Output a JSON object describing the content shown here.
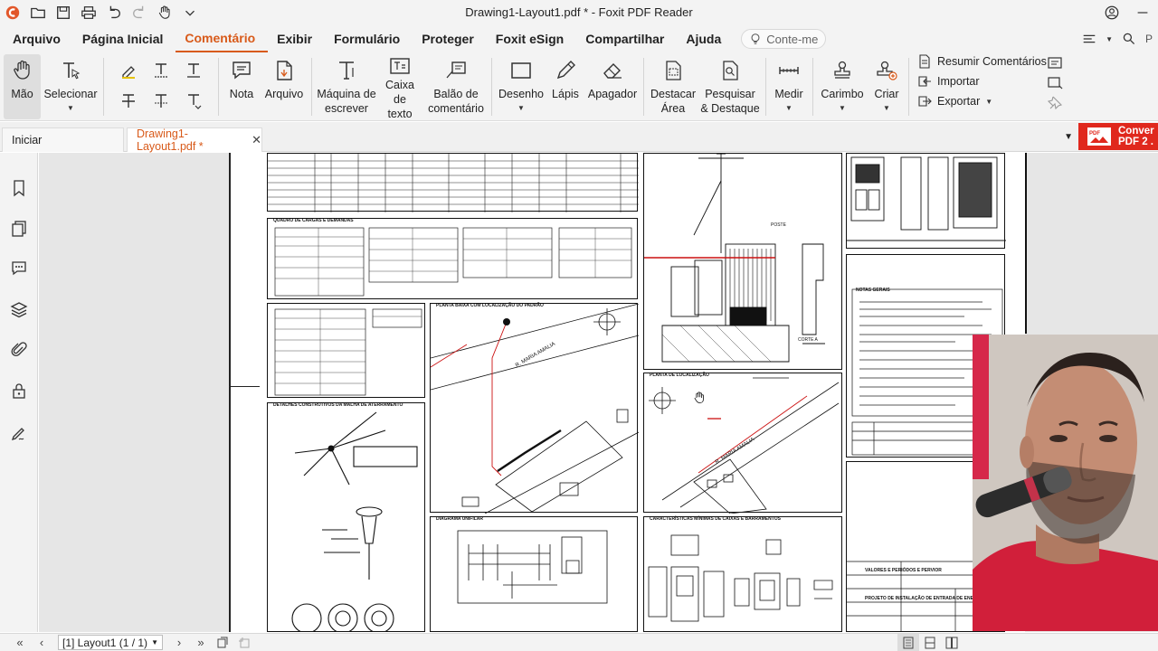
{
  "window": {
    "title": "Drawing1-Layout1.pdf * - Foxit PDF Reader"
  },
  "menu": {
    "items": [
      "Arquivo",
      "Página Inicial",
      "Comentário",
      "Exibir",
      "Formulário",
      "Proteger",
      "Foxit eSign",
      "Compartilhar",
      "Ajuda"
    ],
    "active": "Comentário",
    "search_label": "Conte-me",
    "right_fragment": "P"
  },
  "ribbon": {
    "hand_label": "Mão",
    "select_label": "Selecionar",
    "note_label": "Nota",
    "file_label": "Arquivo",
    "typewriter_label": "Máquina de escrever",
    "textbox_label": "Caixa de texto",
    "callout_label": "Balão de comentário",
    "drawing_label": "Desenho",
    "pencil_label": "Lápis",
    "eraser_label": "Apagador",
    "highlight_area_label": "Destacar Área",
    "search_highlight_label": "Pesquisar & Destaque",
    "measure_label": "Medir",
    "stamp_label": "Carimbo",
    "create_label": "Criar",
    "summarize_label": "Resumir Comentários",
    "import_label": "Importar",
    "export_label": "Exportar"
  },
  "tabs": {
    "home_label": "Iniciar",
    "doc_label": "Drawing1-Layout1.pdf *",
    "convert_line1": "Conver",
    "convert_line2": "PDF 2 ."
  },
  "drawing": {
    "labels": {
      "quadro": "QUADRO DE CARGAS E DEMANDAS",
      "planta_baixa": "PLANTA BAIXA COM LOCALIZAÇÃO DO PADRÃO",
      "detalhes": "DETALHES CONSTRUTIVOS DA MALHA DE ATERRAMENTO",
      "planta_localizacao": "PLANTA DE LOCALIZAÇÃO",
      "diagrama": "DIAGRAMA UNIFILAR",
      "caracteristicas": "CARACTERÍSTICAS MÍNIMAS DE CAIXAS E BARRAMENTOS",
      "street_1": "R. MARIA AMALIA",
      "street_2": "R. MARIA AMALIA",
      "projeto": "PROJETO DE INSTALAÇÃO DE ENTRADA DE ENERGIA",
      "valores": "VALORES E PERIÓDOS E PERVIOR",
      "notas": "NOTAS GERAIS",
      "corte": "CORTE A",
      "poste": "POSTE"
    }
  },
  "status": {
    "page_label": "[1] Layout1 (1 / 1)"
  },
  "colors": {
    "accent": "#d85a1a",
    "convert_red": "#e0281d",
    "drawing_red": "#cc1111"
  }
}
